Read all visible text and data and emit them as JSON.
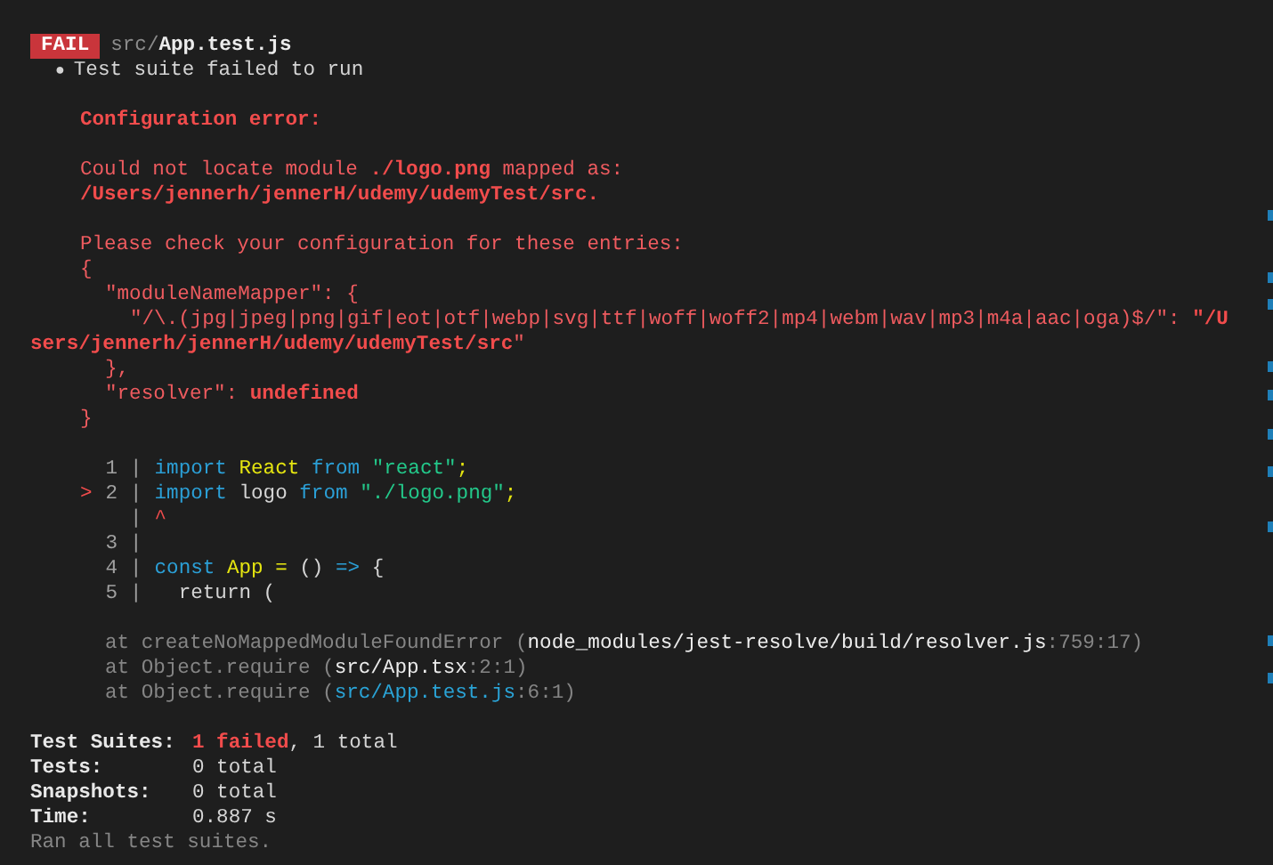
{
  "header": {
    "badge": "FAIL",
    "dir": "src/",
    "file": "App.test.js"
  },
  "suite": {
    "bullet": "●",
    "text": "Test suite failed to run"
  },
  "blocks": [
    {
      "lines": [
        {
          "kind": "top",
          "segs": [
            {
              "text": "Configuration error:",
              "kind": "red_bold"
            }
          ]
        }
      ]
    },
    {
      "lines": [
        {
          "kind": "top",
          "segs": [
            {
              "text": "Could not locate module ",
              "kind": "red"
            },
            {
              "text": "./logo.png",
              "kind": "red_bold"
            },
            {
              "text": " mapped as:",
              "kind": "red"
            }
          ]
        },
        {
          "kind": "top",
          "segs": [
            {
              "text": "/Users/jennerh/jennerH/udemy/udemyTest/src.",
              "kind": "red_bold"
            }
          ]
        }
      ]
    },
    {
      "lines": [
        {
          "kind": "top",
          "segs": [
            {
              "text": "Please check your configuration for these entries:",
              "kind": "red"
            }
          ]
        },
        {
          "kind": "top",
          "segs": [
            {
              "text": "{",
              "kind": "red"
            }
          ]
        },
        {
          "kind": "inner",
          "segs": [
            {
              "text": "\"moduleNameMapper\": {",
              "kind": "red"
            }
          ]
        },
        {
          "kind": "deep",
          "segs": [
            {
              "text": "\"/\\.(jpg|jpeg|png|gif|eot|otf|webp|svg|ttf|woff|woff2|mp4|webm|wav|mp3|m4a|aac|oga)$/\": ",
              "kind": "red"
            },
            {
              "text": "\"/U",
              "kind": "red_bold"
            }
          ]
        },
        {
          "kind": "wrapped",
          "segs": [
            {
              "text": "sers/jennerh/jennerH/udemy/udemyTest/src",
              "kind": "red_bold"
            },
            {
              "text": "\"",
              "kind": "red"
            }
          ]
        },
        {
          "kind": "inner",
          "segs": [
            {
              "text": "},",
              "kind": "red"
            }
          ]
        },
        {
          "kind": "inner",
          "segs": [
            {
              "text": "\"resolver\": ",
              "kind": "red"
            },
            {
              "text": "undefined",
              "kind": "red_bold"
            }
          ]
        },
        {
          "kind": "top",
          "segs": [
            {
              "text": "}",
              "kind": "red"
            }
          ]
        }
      ]
    }
  ],
  "code_frame": [
    {
      "kind": "line",
      "number": "1",
      "gutter": "|",
      "tokens": [
        {
          "text": "import ",
          "kind": "keyword"
        },
        {
          "text": "React ",
          "kind": "ident"
        },
        {
          "text": "from ",
          "kind": "keyword"
        },
        {
          "text": "\"react\"",
          "kind": "string"
        },
        {
          "text": ";",
          "kind": "ident"
        }
      ]
    },
    {
      "kind": "line",
      "pointer": ">",
      "number": "2",
      "gutter": "|",
      "tokens": [
        {
          "text": "import",
          "kind": "keyword"
        },
        {
          "text": " logo ",
          "kind": "plain"
        },
        {
          "text": "from ",
          "kind": "keyword"
        },
        {
          "text": "\"./logo.png\"",
          "kind": "string"
        },
        {
          "text": ";",
          "kind": "ident"
        }
      ]
    },
    {
      "kind": "caret",
      "gutter": "|",
      "caret": "^"
    },
    {
      "kind": "line",
      "number": "3",
      "gutter": "|"
    },
    {
      "kind": "line",
      "number": "4",
      "gutter": "|",
      "tokens": [
        {
          "text": "const ",
          "kind": "keyword"
        },
        {
          "text": "App = ",
          "kind": "ident"
        },
        {
          "text": "() ",
          "kind": "plain"
        },
        {
          "text": "=>",
          "kind": "keyword"
        },
        {
          "text": " {",
          "kind": "plain"
        }
      ]
    },
    {
      "kind": "line",
      "number": "5",
      "gutter": "|",
      "tokens": [
        {
          "text": "  return (",
          "kind": "plain"
        }
      ]
    }
  ],
  "stack": [
    [
      {
        "text": "at createNoMappedModuleFoundError (",
        "kind": "dim"
      },
      {
        "text": "node_modules/jest-resolve/build/resolver.js",
        "kind": "white"
      },
      {
        "text": ":759:17)",
        "kind": "dim"
      }
    ],
    [
      {
        "text": "at Object.require (",
        "kind": "dim"
      },
      {
        "text": "src/App.tsx",
        "kind": "white"
      },
      {
        "text": ":2:1)",
        "kind": "dim"
      }
    ],
    [
      {
        "text": "at Object.require (",
        "kind": "dim"
      },
      {
        "text": "src/App.test.js",
        "kind": "link"
      },
      {
        "text": ":6:1)",
        "kind": "dim"
      }
    ]
  ],
  "summary": [
    {
      "label": "Test Suites:",
      "value": [
        {
          "text": "1 failed",
          "kind": "red_bold"
        },
        {
          "text": ", 1 total",
          "kind": "plain"
        }
      ]
    },
    {
      "label": "Tests:",
      "value": [
        {
          "text": "0 total",
          "kind": "plain"
        }
      ]
    },
    {
      "label": "Snapshots:",
      "value": [
        {
          "text": "0 total",
          "kind": "plain"
        }
      ]
    },
    {
      "label": "Time:",
      "value": [
        {
          "text": "0.887 s",
          "kind": "plain"
        }
      ]
    }
  ],
  "summary_note": "Ran all test suites."
}
